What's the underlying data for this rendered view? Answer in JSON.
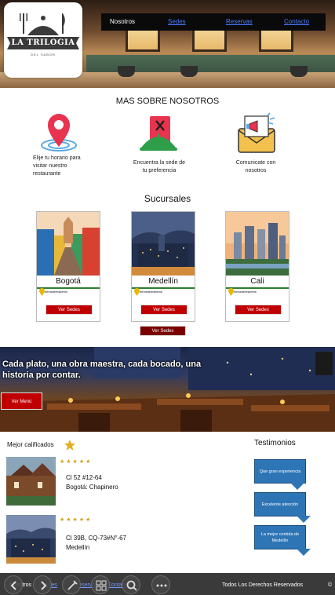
{
  "nav": {
    "home": "Nosotros",
    "links": [
      "Sedes",
      "Reservas",
      "Contacto"
    ]
  },
  "logo": {
    "name": "LA TRILOGIA",
    "subtitle": "DEL SABOR"
  },
  "about": {
    "title": "MAS SOBRE NOSOTROS",
    "features": [
      {
        "icon": "location-pin-icon",
        "text": "Elije tu horario para visitar nuestro restaurante"
      },
      {
        "icon": "menu-dish-icon",
        "text": "Encuentra la sede de tu preferencia"
      },
      {
        "icon": "mail-megaphone-icon",
        "text": "Comunicate con nosotros"
      }
    ]
  },
  "branches": {
    "title": "Sucursales",
    "items": [
      {
        "name": "Bogotá",
        "address": "Itemsitemsitems",
        "button": "Ver Sedes"
      },
      {
        "name": "Medellín",
        "address": "Itemsitemsitems",
        "button": "Ver Sedes"
      },
      {
        "name": "Cali",
        "address": "Itemsitemsitems",
        "button": "Ver Sedes"
      }
    ],
    "all_button": "Ver Sedes"
  },
  "banner": {
    "tagline": "Cada plato, una obra maestra, cada bocado, una historia por contar.",
    "button": "Ver Menú"
  },
  "best": {
    "title": "Mejor calificados",
    "items": [
      {
        "stars": "★★★★★",
        "address_line1": "Cl 52 #12-64",
        "address_line2": "Bogotá: Chapinero"
      },
      {
        "stars": "★★★★★",
        "address_line1": "Cl 39B, CQ-73#N°-67",
        "address_line2": "Medellín"
      }
    ]
  },
  "testimonials": {
    "title": "Testimonios",
    "items": [
      "Que gran experiencia",
      "Excelente atención",
      "La mejor comida de Medellín"
    ]
  },
  "footer": {
    "home": "Nosotros",
    "links": [
      "Sedes",
      "Reservas",
      "Contacto"
    ],
    "rights": "Todos Los Derechos Reservados",
    "copyright_icon": "©"
  },
  "colors": {
    "accent_red": "#c00000",
    "dark_red": "#7a0000",
    "nav_bg": "#0a0a0a",
    "bubble_blue": "#2e75b6",
    "link_blue": "#4a7bff"
  }
}
